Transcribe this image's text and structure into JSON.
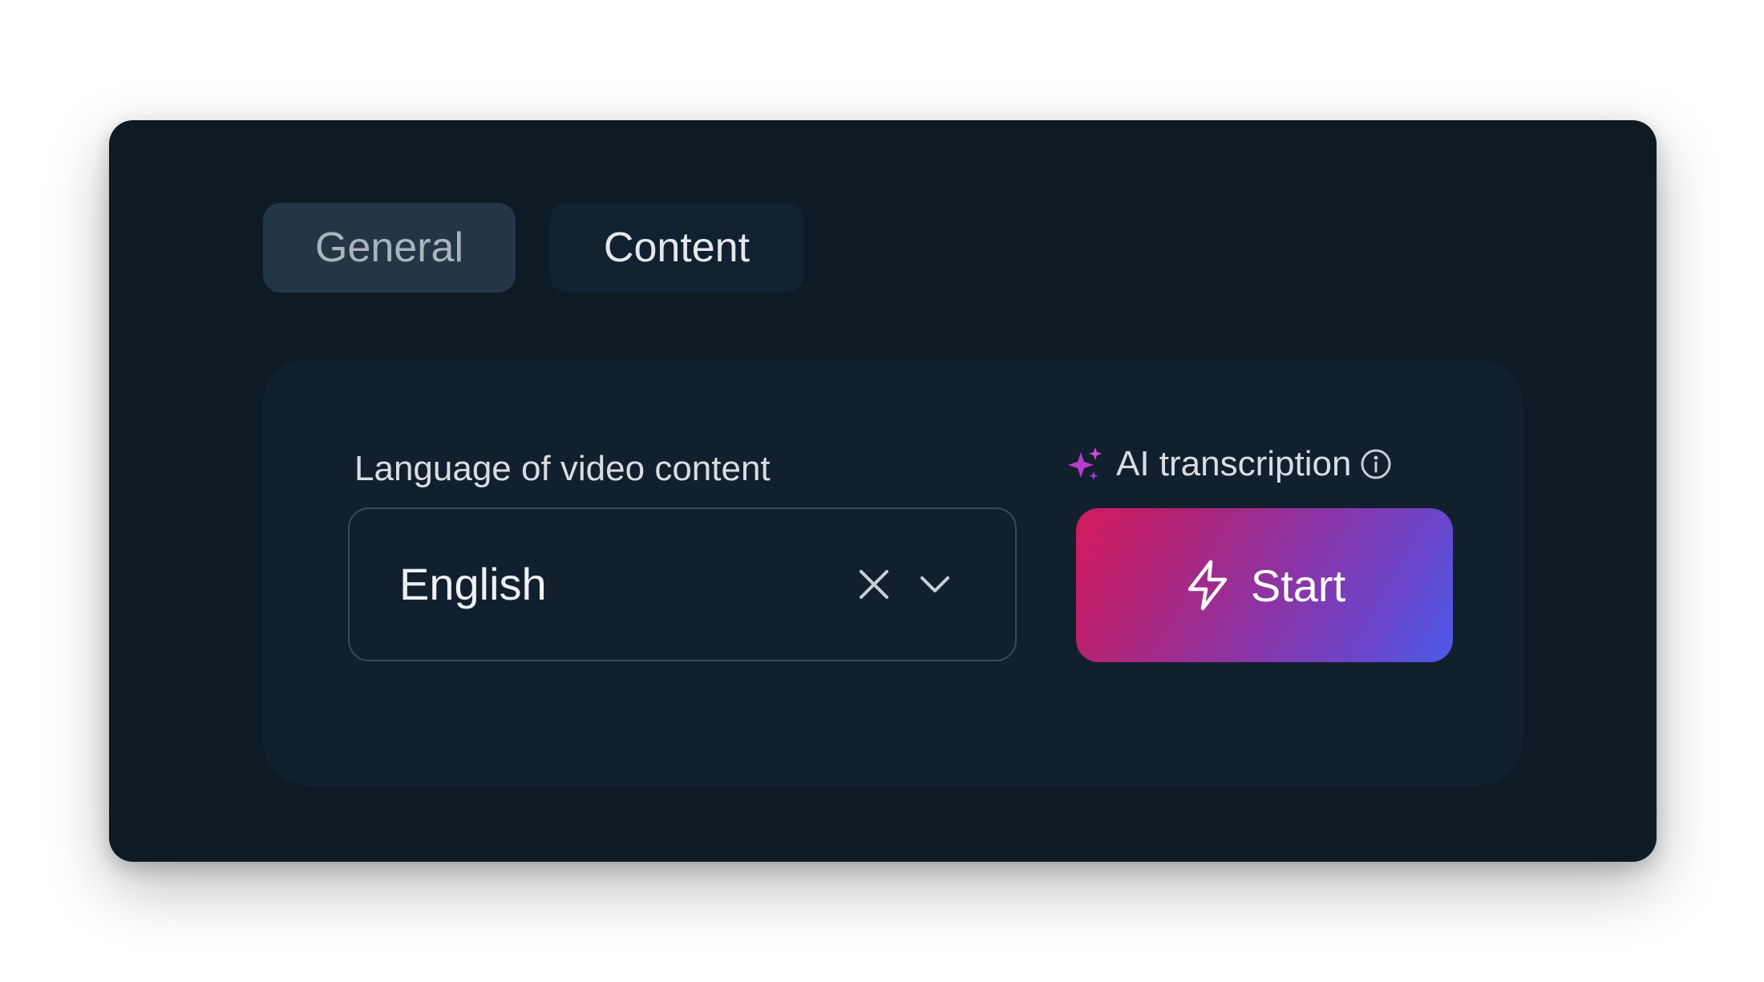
{
  "tabs": [
    {
      "label": "General",
      "active": true
    },
    {
      "label": "Content",
      "active": false
    }
  ],
  "language_field": {
    "label": "Language of video content",
    "selected_value": "English"
  },
  "ai_transcription": {
    "label": "AI transcription",
    "button_label": "Start"
  },
  "icons": {
    "clear": "close-icon",
    "dropdown": "chevron-down-icon",
    "ai": "sparkle-icon",
    "info": "info-icon",
    "start": "lightning-bolt-icon"
  },
  "colors": {
    "card_background": "#0e1a24",
    "panel_background": "#12202e",
    "active_tab": "#243646",
    "inactive_tab": "#122130",
    "button_gradient_start": "#d41a5c",
    "button_gradient_end": "#4a5ae8",
    "sparkle": "#c04ad8"
  }
}
